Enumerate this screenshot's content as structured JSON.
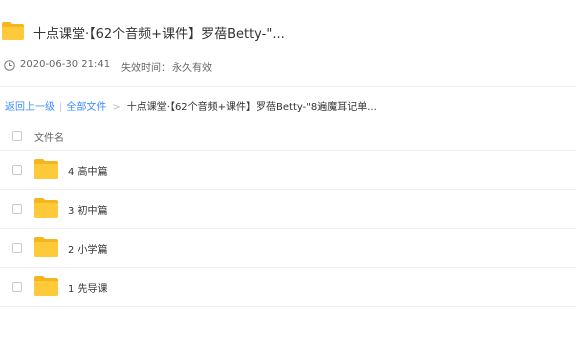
{
  "header": {
    "title": "十点课堂·【62个音频+课件】罗蓓Betty-\"...",
    "folder_icon": "folder-icon"
  },
  "meta": {
    "clock_icon": "clock-icon",
    "date": "2020-06-30 21:41",
    "expire_label": "失效时间：",
    "expire_value": "永久有效"
  },
  "breadcrumb": {
    "back": "返回上一级",
    "separator": "|",
    "all_files": "全部文件",
    "arrow": ">",
    "current": "十点课堂·【62个音频+课件】罗蓓Betty-\"8遍魔耳记单..."
  },
  "list": {
    "column_name": "文件名",
    "items": [
      {
        "name": "4 高中篇"
      },
      {
        "name": "3 初中篇"
      },
      {
        "name": "2 小学篇"
      },
      {
        "name": "1 先导课"
      }
    ]
  },
  "colors": {
    "folder": "#ffca3a",
    "folder_dark": "#f5b51f",
    "link": "#3b8cff"
  }
}
